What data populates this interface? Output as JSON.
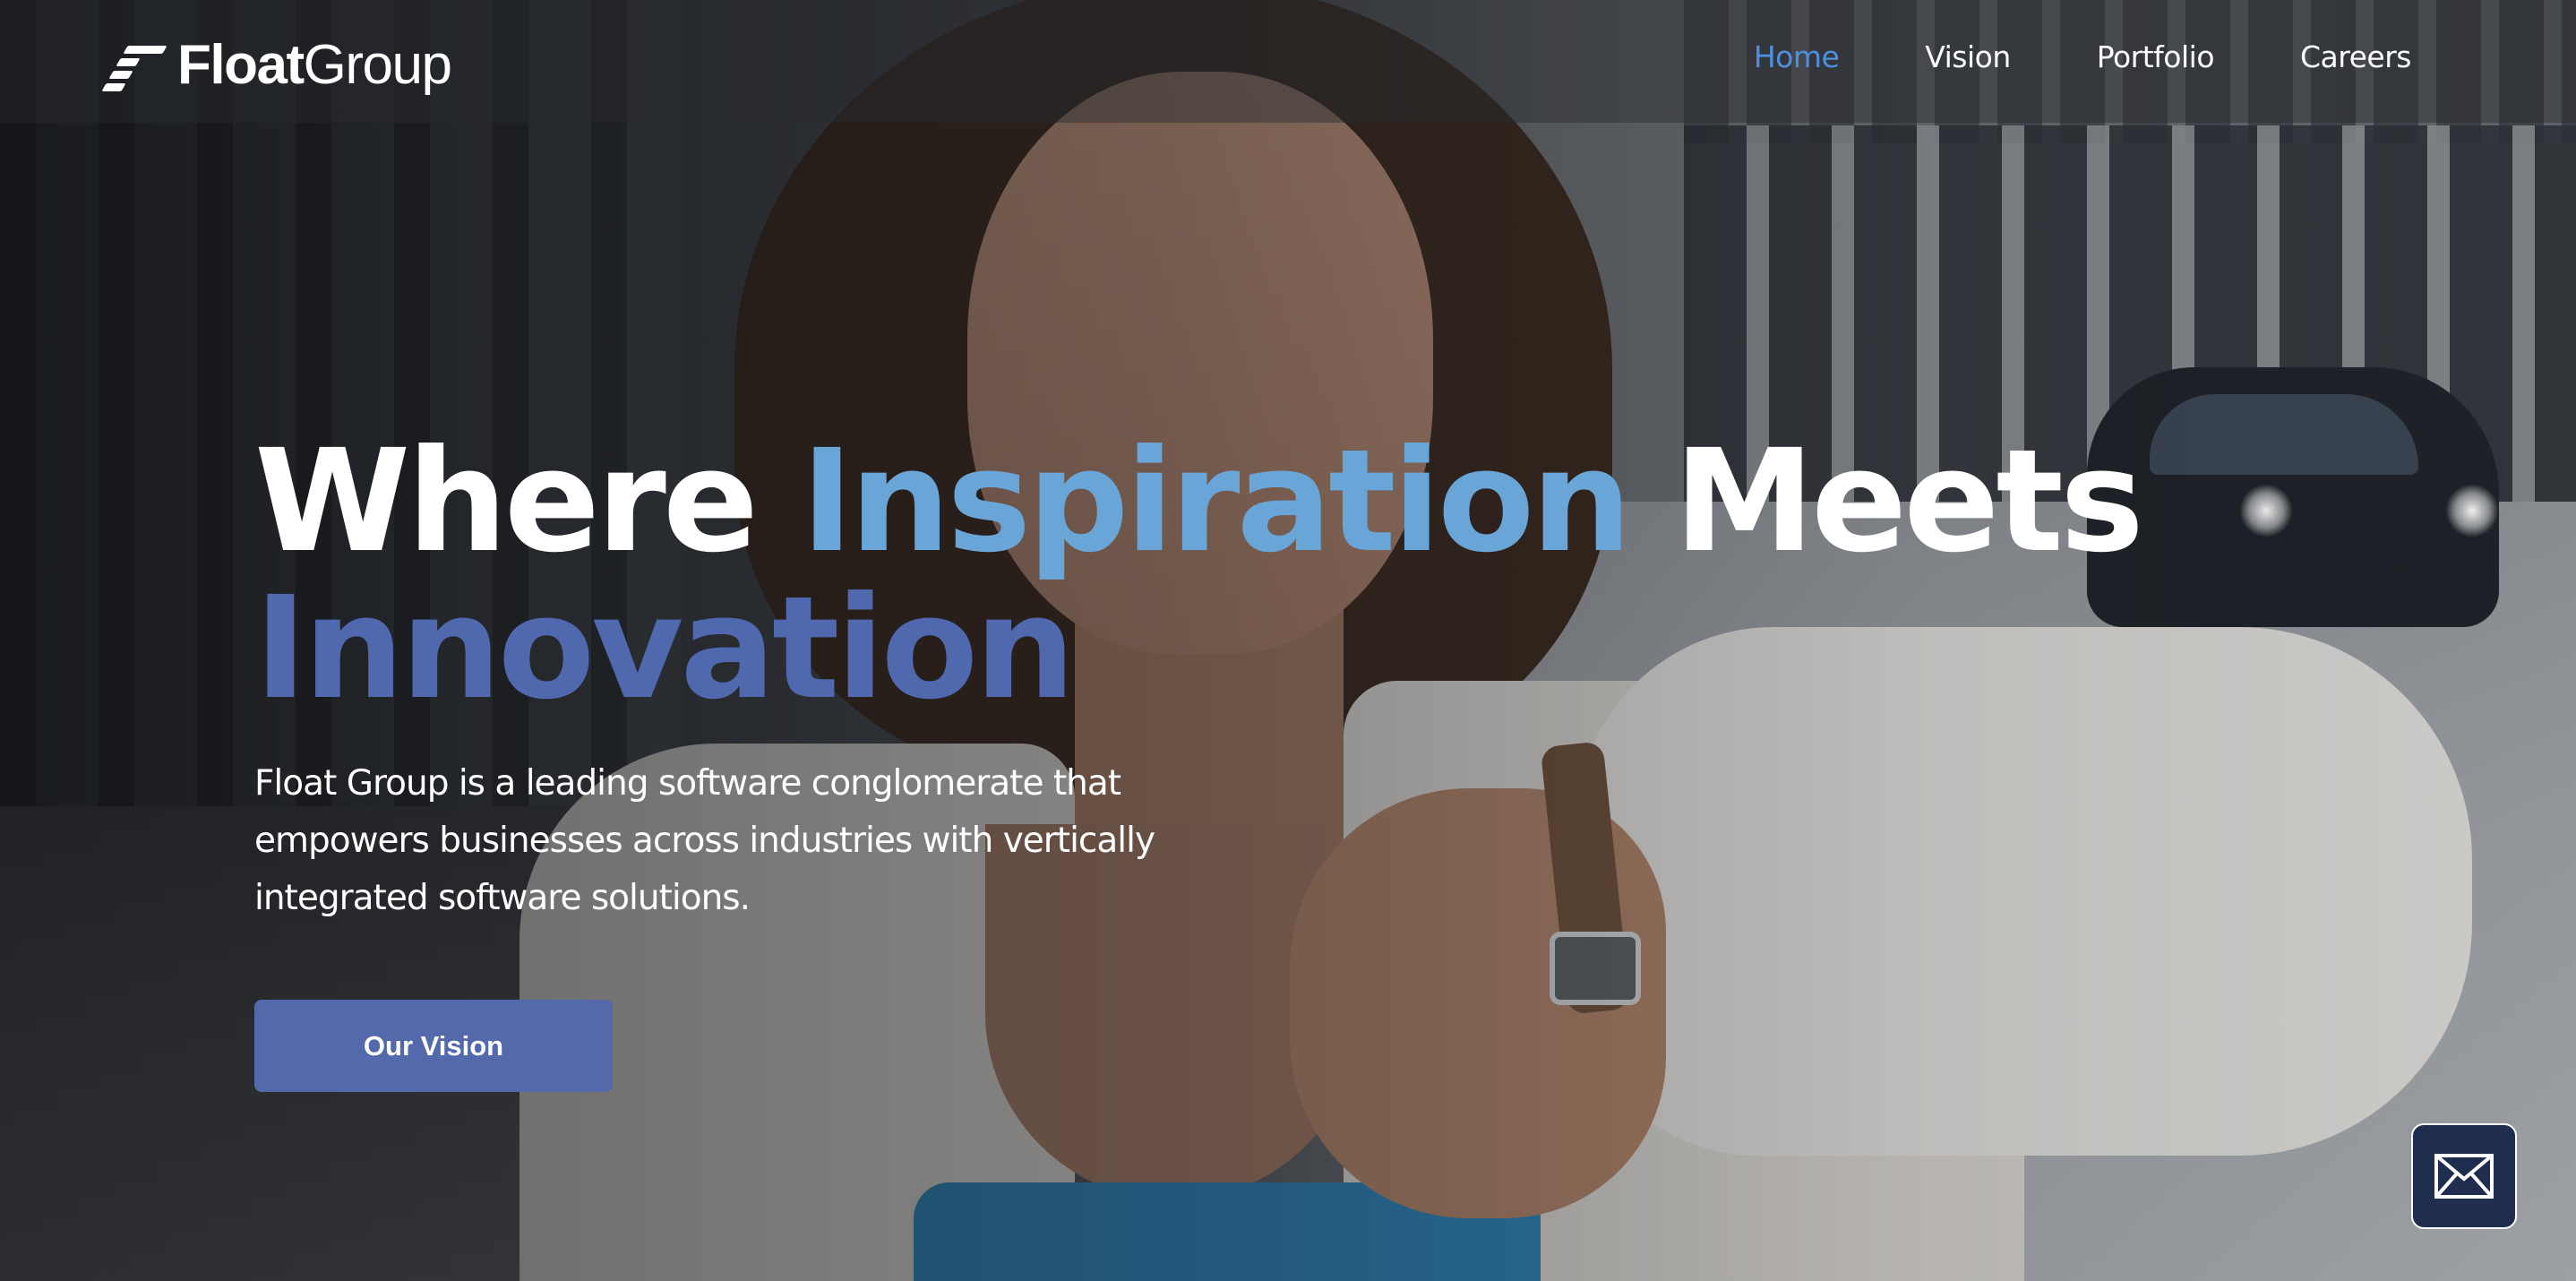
{
  "brand": {
    "name_bold": "Float",
    "name_light": "Group",
    "logo_icon": "float-group-logo-icon"
  },
  "nav": {
    "items": [
      {
        "label": "Home",
        "active": true
      },
      {
        "label": "Vision",
        "active": false
      },
      {
        "label": "Portfolio",
        "active": false
      },
      {
        "label": "Careers",
        "active": false
      }
    ],
    "active_color": "#4e90e0"
  },
  "hero": {
    "title_part1": "Where ",
    "title_accent1": "Inspiration",
    "title_part2": " Meets",
    "title_accent2": "Innovation",
    "description": "Float Group is a leading software conglomerate that empowers businesses across industries with vertically integrated software solutions.",
    "cta_label": "Our Vision",
    "colors": {
      "accent1": "#6aa5d8",
      "accent2": "#4f68ae",
      "cta_bg": "#5369ac"
    }
  },
  "contact": {
    "icon": "envelope-icon",
    "bg": "#1f2d4f"
  }
}
